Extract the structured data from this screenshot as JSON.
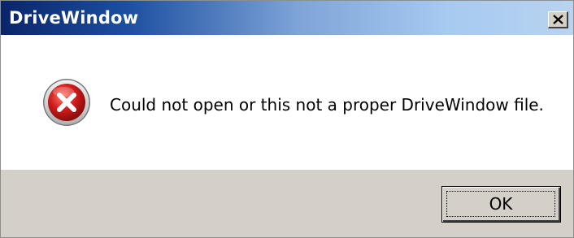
{
  "window": {
    "title": "DriveWindow",
    "close_icon": "close-icon"
  },
  "dialog": {
    "icon": "error-icon",
    "message": "Could not open or this not a proper DriveWindow file.",
    "ok_label": "OK"
  },
  "colors": {
    "titlebar_start": "#0a246a",
    "titlebar_end": "#b9d3f0",
    "error_red": "#d01a1a",
    "footer_gray": "#d4d0c8"
  }
}
